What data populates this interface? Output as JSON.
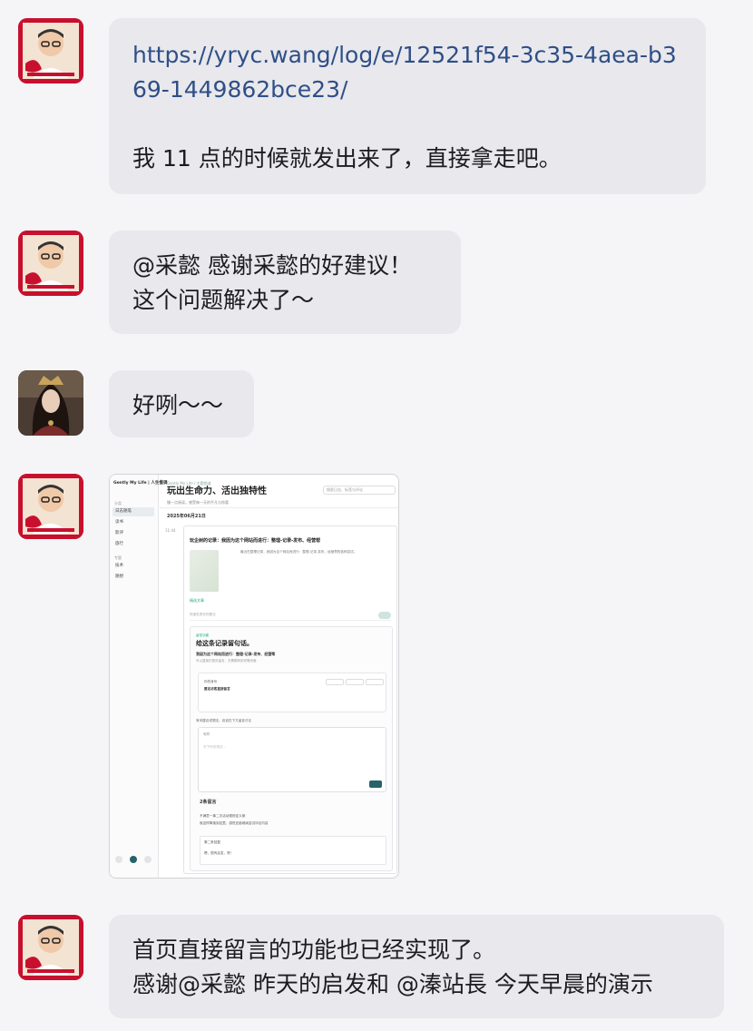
{
  "messages": [
    {
      "sender": "self",
      "link": "https://yryc.wang/log/e/12521f54-3c35-4aea-b369-1449862bce23/",
      "text": "我 11 点的时候就发出来了，直接拿走吧。"
    },
    {
      "sender": "self",
      "lines": [
        "@采懿 感谢采懿的好建议！",
        "这个问题解决了～"
      ]
    },
    {
      "sender": "other",
      "text": "好咧～～"
    },
    {
      "sender": "self",
      "type": "image",
      "image": {
        "brand": "Gently My Life | 人生慢调",
        "sidebar_section_1": "分类",
        "sidebar_items": [
          "日志随笔",
          "读书",
          "影评",
          "旅行"
        ],
        "sidebar_section_2": "专题",
        "sidebar_items_2": [
          "技术",
          "随想"
        ],
        "breadcrumb": "Gently My Life / 主题频道",
        "title": "玩出生命力、活出独特性",
        "subtitle": "慢一点阅读，感受每一天的平凡与惊喜",
        "search_placeholder": "搜索日志、标签与评论",
        "date": "2025年06月21日",
        "time": "11:44",
        "card_title": "玩企树的记录：我因为这个网站而进行：整理-记录-发布、经营帮",
        "card_text": "最近在整理记录，我因为这个网站而进行：整理-记录-发布、经营帮的各种尝试。",
        "card_tag": "精选文章",
        "input_placeholder": "快速发表你的看法",
        "panel_hint": "留言功能",
        "panel_title": "给这条记录留句话。",
        "panel_subtitle": "我因为这个网站而进行：整理-记录-发布、经营帮",
        "panel_desc": "可以直接在首页留言，无需跳转到详情页面",
        "box_label_1": "你的身份",
        "box_label_2": "匿名访客直接留言",
        "tip": "有何建议或想法，欢迎在下方留言讨论",
        "editor_name": "昵称",
        "editor_body": "写下你的想法...",
        "count": "2条留言",
        "comment_1": "不满意一事二次活动规则定义案",
        "comment_2": "就这样降落到这里，感觉还能继续尝试评论内容",
        "reply_1": "第二条回复",
        "reply_2": "嗯，很有启发，赞！"
      }
    },
    {
      "sender": "self",
      "lines": [
        "首页直接留言的功能也已经实现了。",
        "感谢@采懿 昨天的启发和 @溱站長 今天早晨的演示"
      ]
    }
  ]
}
